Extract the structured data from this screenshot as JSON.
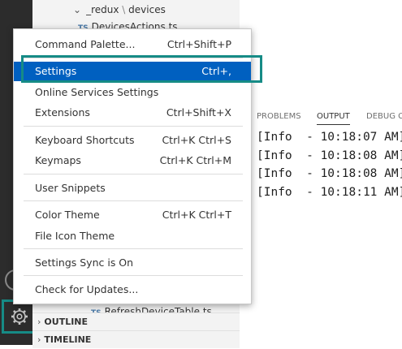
{
  "explorer": {
    "folder_name": "_redux",
    "folder_sep": "\\",
    "subfolder_name": "devices",
    "file_badge": "TS",
    "file_top": "DevicesActions.ts",
    "file_bottom": "RefreshDeviceTable.ts"
  },
  "sections": {
    "outline": "OUTLINE",
    "timeline": "TIMELINE"
  },
  "panel": {
    "tabs": [
      "PROBLEMS",
      "OUTPUT",
      "DEBUG C"
    ],
    "active_tab": "OUTPUT",
    "output_lines": [
      "[Info  - 10:18:07 AM]",
      "[Info  - 10:18:08 AM]",
      "[Info  - 10:18:08 AM]",
      "[Info  - 10:18:11 AM]"
    ]
  },
  "menu": {
    "items": [
      {
        "label": "Command Palette...",
        "shortcut": "Ctrl+Shift+P"
      },
      {
        "label": "Settings",
        "shortcut": "Ctrl+,",
        "selected": true
      },
      {
        "label": "Online Services Settings",
        "shortcut": ""
      },
      {
        "label": "Extensions",
        "shortcut": "Ctrl+Shift+X"
      },
      {
        "label": "Keyboard Shortcuts",
        "shortcut": "Ctrl+K Ctrl+S"
      },
      {
        "label": "Keymaps",
        "shortcut": "Ctrl+K Ctrl+M"
      },
      {
        "label": "User Snippets",
        "shortcut": ""
      },
      {
        "label": "Color Theme",
        "shortcut": "Ctrl+K Ctrl+T"
      },
      {
        "label": "File Icon Theme",
        "shortcut": ""
      },
      {
        "label": "Settings Sync is On",
        "shortcut": ""
      },
      {
        "label": "Check for Updates...",
        "shortcut": ""
      }
    ]
  },
  "icons": {
    "manage": "gear-icon",
    "account": "account-icon",
    "chevron": "chevron-icon"
  },
  "colors": {
    "activity_bar": "#2c2c2c",
    "selection": "#0060c0",
    "highlight": "#168b86"
  }
}
